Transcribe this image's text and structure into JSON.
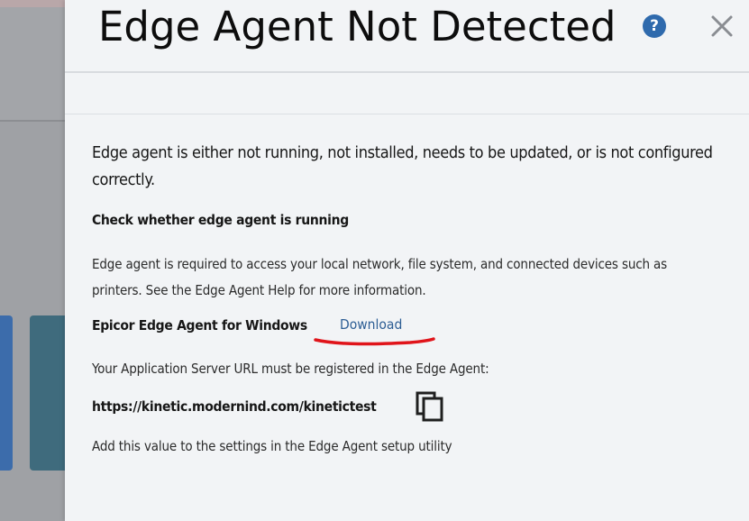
{
  "dialog": {
    "title": "Edge Agent Not Detected",
    "help_icon": "question-circle-icon",
    "help_symbol": "?",
    "close_icon": "close-icon"
  },
  "content": {
    "lead": "Edge agent is either not running, not installed, needs to be updated, or is not configured correctly.",
    "check_heading": "Check whether edge agent is running",
    "info": "Edge agent is required to access your local network, file system, and connected devices such as printers. See the Edge Agent Help for more information.",
    "agent_label": "Epicor Edge Agent for Windows",
    "download_label": "Download",
    "url_note": "Your Application Server URL must be registered in the Edge Agent:",
    "server_url": "https://kinetic.modernind.com/kinetictest",
    "copy_icon": "copy-icon",
    "settings_note": "Add this value to the settings in the Edge Agent setup utility"
  },
  "colors": {
    "accent": "#2f6aad",
    "link": "#2c5d94",
    "annotation": "#e0141a",
    "panel_bg": "#f2f4f6"
  }
}
